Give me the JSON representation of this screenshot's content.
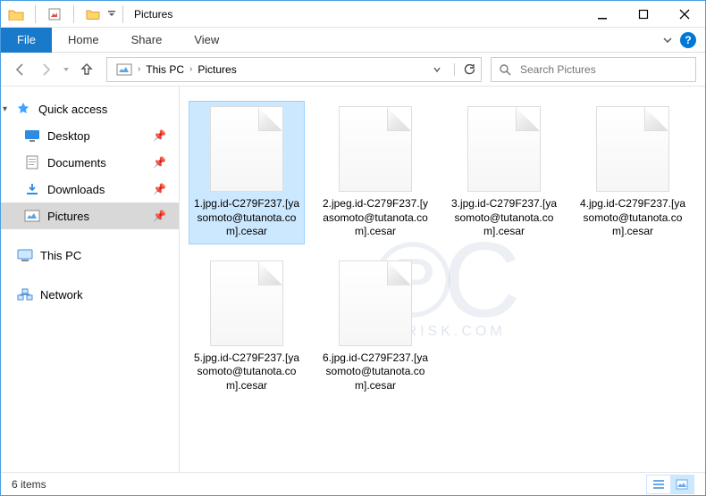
{
  "titlebar": {
    "title": "Pictures"
  },
  "ribbon": {
    "file": "File",
    "tabs": [
      "Home",
      "Share",
      "View"
    ]
  },
  "breadcrumb": {
    "segments": [
      "This PC",
      "Pictures"
    ]
  },
  "search": {
    "placeholder": "Search Pictures"
  },
  "sidebar": {
    "quick_access": "Quick access",
    "items": [
      {
        "label": "Desktop",
        "pinned": true
      },
      {
        "label": "Documents",
        "pinned": true
      },
      {
        "label": "Downloads",
        "pinned": true
      },
      {
        "label": "Pictures",
        "pinned": true,
        "selected": true
      }
    ],
    "this_pc": "This PC",
    "network": "Network"
  },
  "files": [
    {
      "name": "1.jpg.id-C279F237.[yasomoto@tutanota.com].cesar",
      "selected": true
    },
    {
      "name": "2.jpeg.id-C279F237.[yasomoto@tutanota.com].cesar"
    },
    {
      "name": "3.jpg.id-C279F237.[yasomoto@tutanota.com].cesar"
    },
    {
      "name": "4.jpg.id-C279F237.[yasomoto@tutanota.com].cesar"
    },
    {
      "name": "5.jpg.id-C279F237.[yasomoto@tutanota.com].cesar"
    },
    {
      "name": "6.jpg.id-C279F237.[yasomoto@tutanota.com].cesar"
    }
  ],
  "statusbar": {
    "count_label": "6 items"
  },
  "watermark": {
    "logo": "℗C",
    "site": "PCRISK.COM"
  }
}
